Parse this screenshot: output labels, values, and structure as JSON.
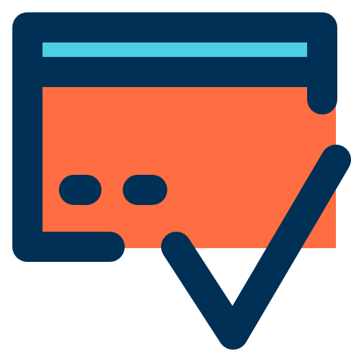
{
  "icon": {
    "name": "credit-card-approved-icon",
    "colors": {
      "outline": "#003055",
      "stripe": "#4ACFE3",
      "card_fill": "#FF6D42",
      "background": "#FFFFFF"
    }
  }
}
